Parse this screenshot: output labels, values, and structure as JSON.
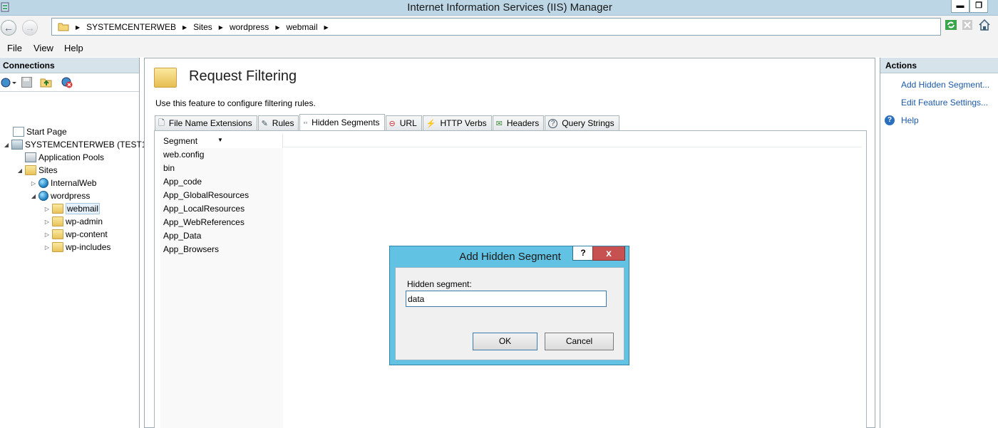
{
  "window": {
    "title": "Internet Information Services (IIS) Manager",
    "minimize_glyph": "▬",
    "maximize_glyph": "❐"
  },
  "address": {
    "breadcrumbs": [
      "SYSTEMCENTERWEB",
      "Sites",
      "wordpress",
      "webmail"
    ],
    "back_glyph": "←",
    "forward_glyph": "→",
    "right_icons": [
      "refresh-icon",
      "stop-icon",
      "home-icon"
    ]
  },
  "menu": {
    "items": [
      "File",
      "View",
      "Help"
    ]
  },
  "connections": {
    "header": "Connections",
    "toolbar_icons": [
      "connect-icon",
      "save-icon",
      "up-icon",
      "disconnect-icon"
    ],
    "tree": [
      {
        "label": "Start Page",
        "icon": "start-page-icon",
        "level": 0,
        "expander": ""
      },
      {
        "label": "SYSTEMCENTERWEB (TEST1\\",
        "icon": "server-icon",
        "level": 0,
        "expander": "◢"
      },
      {
        "label": "Application Pools",
        "icon": "app-pools-icon",
        "level": 1,
        "expander": ""
      },
      {
        "label": "Sites",
        "icon": "sites-folder-icon",
        "level": 1,
        "expander": "◢"
      },
      {
        "label": "InternalWeb",
        "icon": "globe-icon",
        "level": 2,
        "expander": "▷"
      },
      {
        "label": "wordpress",
        "icon": "globe-icon",
        "level": 2,
        "expander": "◢"
      },
      {
        "label": "webmail",
        "icon": "folder-icon",
        "level": 3,
        "expander": "▷",
        "selected": true
      },
      {
        "label": "wp-admin",
        "icon": "folder-icon",
        "level": 3,
        "expander": "▷"
      },
      {
        "label": "wp-content",
        "icon": "folder-icon",
        "level": 3,
        "expander": "▷"
      },
      {
        "label": "wp-includes",
        "icon": "folder-icon",
        "level": 3,
        "expander": "▷"
      }
    ]
  },
  "feature": {
    "title": "Request Filtering",
    "description": "Use this feature to configure filtering rules.",
    "tabs": [
      {
        "label": "File Name Extensions",
        "icon": "file-extension-icon",
        "glyph": "🗋"
      },
      {
        "label": "Rules",
        "icon": "rules-icon",
        "glyph": "✎"
      },
      {
        "label": "Hidden Segments",
        "icon": "hidden-segments-icon",
        "glyph": "▫▫",
        "active": true
      },
      {
        "label": "URL",
        "icon": "url-deny-icon",
        "glyph": "⊖"
      },
      {
        "label": "HTTP Verbs",
        "icon": "http-verbs-icon",
        "glyph": "⚡"
      },
      {
        "label": "Headers",
        "icon": "headers-icon",
        "glyph": "✉"
      },
      {
        "label": "Query Strings",
        "icon": "query-strings-icon",
        "glyph": "?"
      }
    ],
    "table": {
      "column_header": "Segment",
      "sort_glyph": "▼",
      "rows": [
        "web.config",
        "bin",
        "App_code",
        "App_GlobalResources",
        "App_LocalResources",
        "App_WebReferences",
        "App_Data",
        "App_Browsers"
      ]
    }
  },
  "actions": {
    "header": "Actions",
    "links": [
      "Add Hidden Segment...",
      "Edit Feature Settings..."
    ],
    "help": "Help",
    "help_glyph": "?"
  },
  "dialog": {
    "title": "Add Hidden Segment",
    "help_glyph": "?",
    "close_glyph": "x",
    "field_label": "Hidden segment:",
    "field_value": "data",
    "ok_label": "OK",
    "cancel_label": "Cancel"
  },
  "colors": {
    "titlebar": "#bcd6e5",
    "dialog_frame": "#62c2e3",
    "close_button": "#c75050",
    "link": "#1c5aa6",
    "panel_header": "#d6e3ea"
  }
}
